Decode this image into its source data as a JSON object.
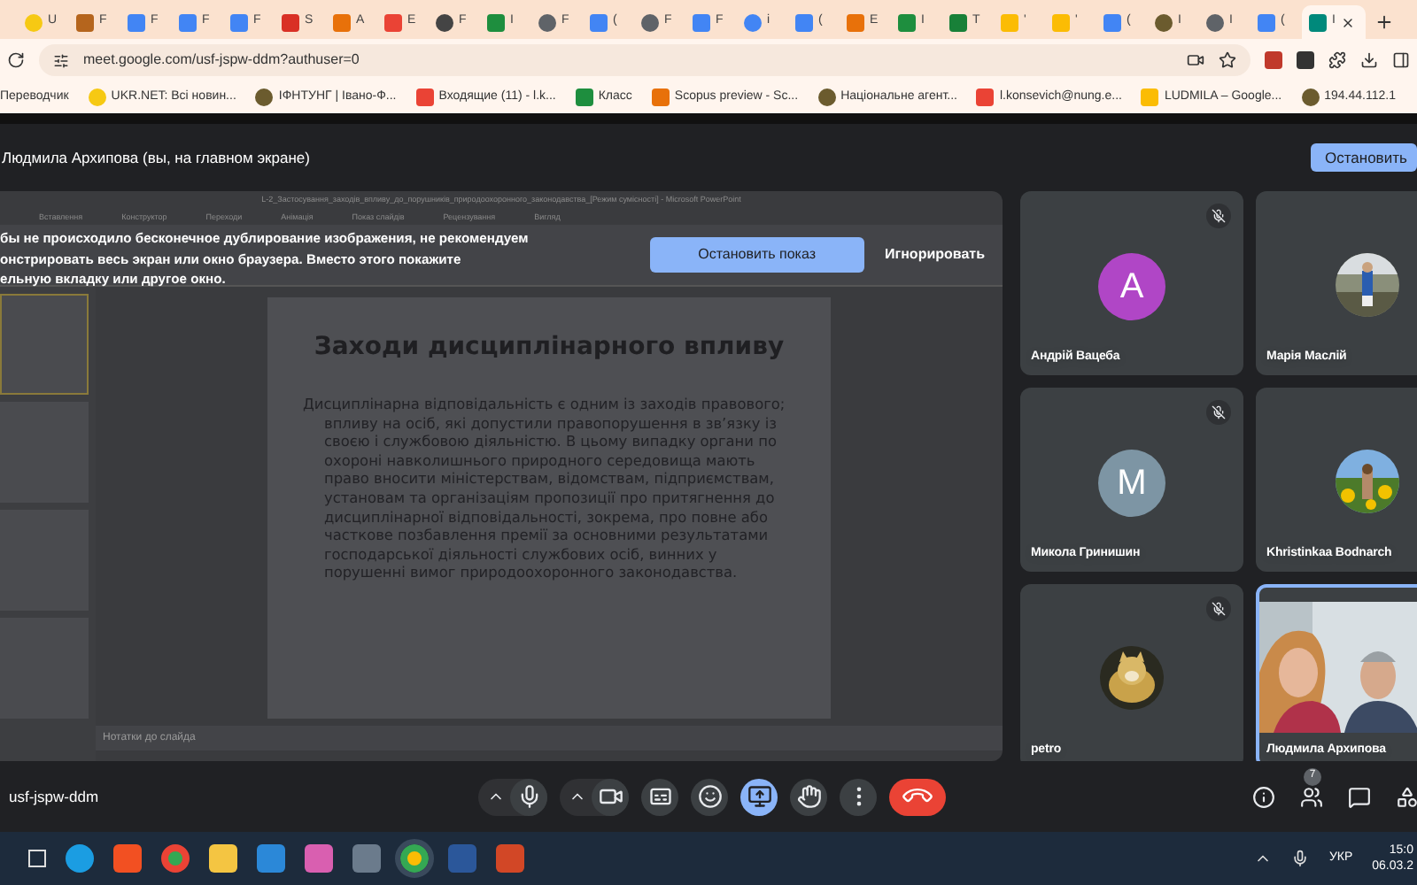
{
  "browser": {
    "tabs": [
      {
        "kind": "circle",
        "label": "U",
        "selected": false
      },
      {
        "label": "F",
        "selected": false
      },
      {
        "kind": "doc",
        "label": "F",
        "selected": false
      },
      {
        "kind": "doc",
        "label": "F",
        "selected": false
      },
      {
        "kind": "doc",
        "label": "F",
        "selected": false
      },
      {
        "kind": "thermo",
        "label": "S",
        "selected": false
      },
      {
        "kind": "orange",
        "label": "A",
        "selected": false
      },
      {
        "kind": "mail",
        "label": "E",
        "selected": false
      },
      {
        "kind": "gear",
        "label": "F",
        "selected": false
      },
      {
        "kind": "classroom",
        "label": "I",
        "selected": false
      },
      {
        "kind": "chrome",
        "label": "F",
        "selected": false
      },
      {
        "kind": "translate",
        "label": "(",
        "selected": false
      },
      {
        "kind": "chrome",
        "label": "F",
        "selected": false
      },
      {
        "kind": "doc",
        "label": "F",
        "selected": false
      },
      {
        "kind": "google",
        "label": "i",
        "selected": false
      },
      {
        "kind": "translate",
        "label": "(",
        "selected": false
      },
      {
        "kind": "orange",
        "label": "E",
        "selected": false
      },
      {
        "kind": "classroom",
        "label": "I",
        "selected": false
      },
      {
        "kind": "sheets",
        "label": "T",
        "selected": false
      },
      {
        "kind": "drive",
        "label": "'",
        "selected": false
      },
      {
        "kind": "drive",
        "label": "'",
        "selected": false
      },
      {
        "kind": "translate",
        "label": "(",
        "selected": false
      },
      {
        "kind": "crest",
        "label": "I",
        "selected": false
      },
      {
        "kind": "chrome",
        "label": "I",
        "selected": false
      },
      {
        "kind": "doc",
        "label": "(",
        "selected": false
      },
      {
        "kind": "meet",
        "label": "I",
        "selected": true
      }
    ],
    "address": "meet.google.com/usf-jspw-ddm?authuser=0",
    "bookmarks": [
      {
        "kind": "none",
        "label": "Переводчик"
      },
      {
        "kind": "circle",
        "label": "UKR.NET: Всі новин..."
      },
      {
        "kind": "crest",
        "label": "ІФНТУНГ | Івано-Ф..."
      },
      {
        "kind": "mail",
        "label": "Входящие (11) - l.k..."
      },
      {
        "kind": "classroom",
        "label": "Класс"
      },
      {
        "kind": "orange",
        "label": "Scopus preview - Sc..."
      },
      {
        "kind": "crest",
        "label": "Національне агент..."
      },
      {
        "kind": "mail",
        "label": "l.konsevich@nung.e..."
      },
      {
        "kind": "drive",
        "label": "LUDMILA – Google..."
      },
      {
        "kind": "crest",
        "label": "194.44.112.1"
      }
    ]
  },
  "meeting": {
    "presenter_label": "Людмила Архипова (вы, на главном экране)",
    "stop_button": "Остановить",
    "shared_window": {
      "title": "L-2_Застосування_заходів_впливу_до_порушників_природоохоронного_законодавства_[Режим сумісності] - Microsoft PowerPoint",
      "ribbon_tabs": [
        "Вставлення",
        "Конструктор",
        "Переходи",
        "Анімація",
        "Показ слайдів",
        "Рецензування",
        "Вигляд"
      ],
      "slide_title": "Заходи дисциплінарного впливу",
      "slide_text": "Дисциплінарна відповідальність є одним із заходів правового; впливу на осіб, які допустили правопорушення в зв’язку із своєю і службовою діяльністю. В цьому випадку органи по охороні навколишнього природного середовища мають право вносити міністерствам, відомствам, підприємствам, установам та організаціям пропозиції про притягнення до дисциплінарної відповідальності, зокрема, про повне або часткове позбавлення премії за основними результатами господарської діяльності службових осіб, винних у порушенні вимог природоохоронного законодавства.",
      "notes_placeholder": "Нотатки до слайда"
    },
    "warning": {
      "lines": [
        "бы не происходило бесконечное дублирование изображения, не рекомендуем",
        "онстрировать весь экран или окно браузера. Вместо этого покажите",
        "ельную вкладку или другое окно."
      ],
      "stop_button": "Остановить показ",
      "ignore_button": "Игнорировать"
    },
    "participants": [
      {
        "name": "Андрій Вацеба",
        "kind": "letter",
        "letter": "A",
        "color": "#b046c6",
        "muted": true,
        "highlighted": false
      },
      {
        "name": "Марія Маслій",
        "highlighted": false
      },
      {
        "name": "Микола Гринишин",
        "kind": "letter",
        "letter": "M",
        "color": "#7d95a4",
        "muted": true,
        "highlighted": false
      },
      {
        "name": "Khristinkaa Bodnarch",
        "kind": "sunflower",
        "highlighted": false
      },
      {
        "name": "petro",
        "kind": "cat",
        "muted": true,
        "highlighted": false
      },
      {
        "name": "Людмила Архипова",
        "kind": "video",
        "highlighted": true
      }
    ],
    "meeting_code": "usf-jspw-ddm",
    "controls": [
      {
        "kind": "mic",
        "active": false
      },
      {
        "kind": "camera",
        "active": false
      },
      {
        "kind": "captions",
        "active": false
      },
      {
        "kind": "emoji",
        "active": false
      },
      {
        "kind": "present",
        "active": true
      },
      {
        "kind": "hand",
        "active": false
      },
      {
        "kind": "more",
        "active": false
      },
      {
        "kind": "hangup"
      }
    ],
    "people_count": "7"
  },
  "taskbar": {
    "language": "УКР",
    "time": "15:0",
    "date": "06.03.2"
  }
}
